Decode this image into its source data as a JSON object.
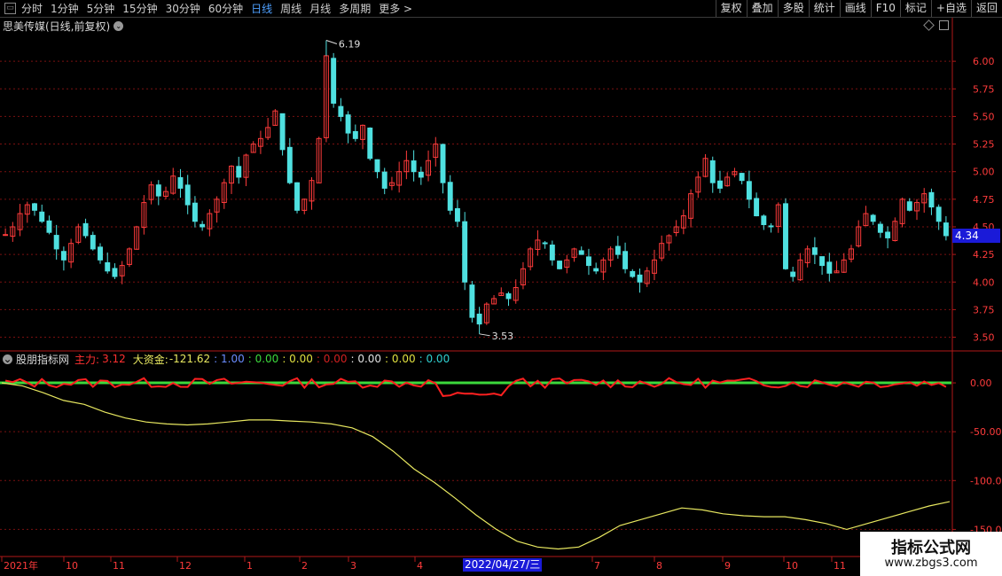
{
  "toolbar": {
    "tabs": [
      "分时",
      "1分钟",
      "5分钟",
      "15分钟",
      "30分钟",
      "60分钟",
      "日线",
      "周线",
      "月线",
      "多周期",
      "更多 >"
    ],
    "active_tab": "日线",
    "buttons": [
      "复权",
      "叠加",
      "多股",
      "统计",
      "画线",
      "F10",
      "标记",
      "+自选",
      "返回"
    ]
  },
  "chart_header": {
    "stock_title": "思美传媒(日线,前复权)"
  },
  "price_axis": {
    "ticks": [
      "6.00",
      "5.75",
      "5.50",
      "5.25",
      "5.00",
      "4.75",
      "4.50",
      "4.25",
      "4.00",
      "3.75",
      "3.50"
    ],
    "current_price": "4.34"
  },
  "annotations": {
    "high": "6.19",
    "low": "3.53"
  },
  "indicator": {
    "name": "股朋指标网",
    "zhuli_label": "主力:",
    "zhuli_value": "3.12",
    "dazijin_label": "大资金:",
    "dazijin_value": "-121.62",
    "extra_values": [
      {
        "text": ": 1.00",
        "color": "#6a8cff"
      },
      {
        "text": ": 0.00",
        "color": "#3cd93c"
      },
      {
        "text": ": 0.00",
        "color": "#e0e040"
      },
      {
        "text": ": 0.00",
        "color": "#d02020"
      },
      {
        "text": ": 0.00",
        "color": "#e0e0e0"
      },
      {
        "text": ": 0.00",
        "color": "#e0e040"
      },
      {
        "text": ": 0.00",
        "color": "#30d0d0"
      }
    ],
    "axis_ticks": [
      "0.00",
      "-50.00",
      "-100.0",
      "-150.0"
    ]
  },
  "date_axis": {
    "labels": [
      "2021年",
      "10",
      "11",
      "12",
      "1",
      "2",
      "3",
      "4",
      "7",
      "8",
      "9",
      "10",
      "11"
    ],
    "highlight": "2022/04/27/三"
  },
  "watermark": {
    "title": "指标公式网",
    "url": "www.zbgs3.com"
  },
  "colors": {
    "up": "#ff3b3b",
    "down": "#4fe0e0",
    "grid": "#7a1010",
    "yellow_line": "#e8e860",
    "green_line": "#3cd93c",
    "red_line": "#ff2020"
  },
  "chart_data": {
    "type": "candlestick",
    "price_range": [
      3.4,
      6.25
    ],
    "indicator_range": [
      -175,
      20
    ],
    "high": 6.19,
    "low": 3.53,
    "last": 4.34,
    "close_path": [
      4.43,
      4.5,
      4.62,
      4.7,
      4.65,
      4.55,
      4.45,
      4.3,
      4.2,
      4.35,
      4.5,
      4.42,
      4.3,
      4.2,
      4.1,
      4.05,
      4.15,
      4.3,
      4.5,
      4.72,
      4.88,
      4.78,
      4.82,
      4.96,
      4.85,
      4.7,
      4.55,
      4.5,
      4.62,
      4.75,
      4.9,
      5.05,
      4.95,
      5.15,
      5.25,
      5.3,
      5.4,
      5.55,
      5.2,
      4.9,
      4.65,
      4.75,
      4.92,
      5.3,
      6.05,
      5.62,
      5.5,
      5.35,
      5.3,
      5.42,
      5.12,
      5.0,
      4.85,
      4.9,
      5.0,
      5.1,
      5.0,
      4.95,
      5.1,
      5.25,
      4.9,
      4.65,
      4.55,
      4.0,
      3.68,
      3.62,
      3.8,
      3.85,
      3.9,
      3.85,
      3.95,
      4.12,
      4.3,
      4.38,
      4.35,
      4.2,
      4.12,
      4.2,
      4.3,
      4.25,
      4.15,
      4.1,
      4.2,
      4.3,
      4.25,
      4.12,
      4.05,
      4.0,
      4.1,
      4.2,
      4.35,
      4.42,
      4.5,
      4.6,
      4.8,
      4.95,
      5.12,
      4.9,
      4.85,
      4.95,
      5.0,
      4.92,
      4.75,
      4.6,
      4.52,
      4.5,
      4.7,
      4.12,
      4.05,
      4.2,
      4.3,
      4.25,
      4.15,
      4.08,
      4.1,
      4.2,
      4.3,
      4.5,
      4.62,
      4.55,
      4.45,
      4.4,
      4.55,
      4.75,
      4.65,
      4.72,
      4.8,
      4.68,
      4.55,
      4.42
    ],
    "yellow_path": [
      0,
      -3,
      -10,
      -18,
      -22,
      -30,
      -36,
      -40,
      -42,
      -43,
      -42,
      -40,
      -38,
      -38,
      -39,
      -40,
      -42,
      -46,
      -55,
      -70,
      -88,
      -102,
      -118,
      -135,
      -150,
      -162,
      -168,
      -170,
      -168,
      -158,
      -146,
      -140,
      -134,
      -128,
      -130,
      -134,
      -136,
      -137,
      -137,
      -140,
      -144,
      -150,
      -144,
      -138,
      -132,
      -126,
      -121.62
    ],
    "zhuli_last": 3.12,
    "dazijin_last": -121.62
  }
}
